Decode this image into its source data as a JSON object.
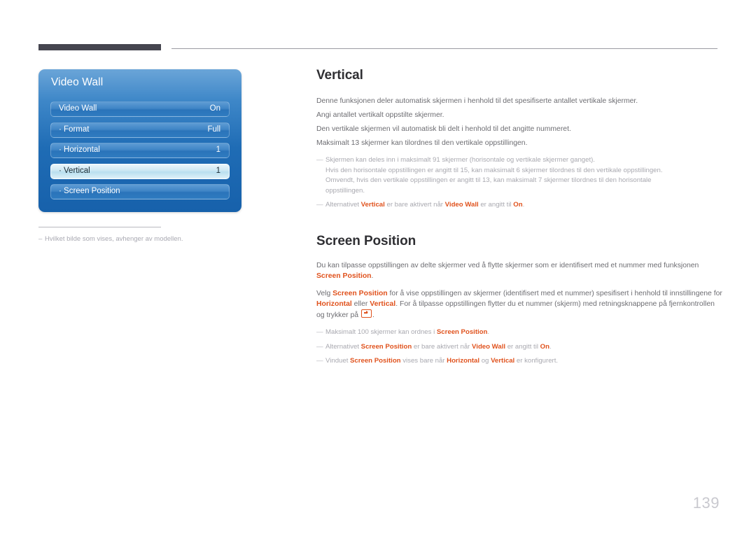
{
  "page": {
    "number": "139"
  },
  "osd": {
    "title": "Video Wall",
    "rows": [
      {
        "label": "Video Wall",
        "value": "On",
        "selected": false
      },
      {
        "label": "· Format",
        "value": "Full",
        "selected": false
      },
      {
        "label": "· Horizontal",
        "value": "1",
        "selected": false
      },
      {
        "label": "· Vertical",
        "value": "1",
        "selected": true
      },
      {
        "label": "· Screen Position",
        "value": "",
        "selected": false
      }
    ]
  },
  "panel_footnote": {
    "dash": "–",
    "text": "Hvilket bilde som vises, avhenger av modellen."
  },
  "vertical_section": {
    "heading": "Vertical",
    "lines": [
      "Denne funksjonen deler automatisk skjermen i henhold til det spesifiserte antallet vertikale skjermer.",
      "Angi antallet vertikalt oppstilte skjermer.",
      "Den vertikale skjermen vil automatisk bli delt i henhold til det angitte nummeret.",
      "Maksimalt 13 skjermer kan tilordnes til den vertikale oppstillingen."
    ],
    "note1": {
      "dash": "—",
      "line1": "Skjermen kan deles inn i maksimalt 91 skjermer (horisontale og vertikale skjermer ganget).",
      "line2": "Hvis den horisontale oppstillingen er angitt til 15, kan maksimalt 6 skjermer tilordnes til den vertikale oppstillingen.",
      "line3": "Omvendt, hvis den vertikale oppstillingen er angitt til 13, kan maksimalt 7 skjermer tilordnes til den horisontale",
      "line4": "oppstillingen."
    },
    "note2": {
      "dash": "—",
      "part1": "Alternativet ",
      "kw1": "Vertical",
      "part2": " er bare aktivert når ",
      "kw2": "Video Wall",
      "part3": " er angitt til ",
      "kw3": "On",
      "part4": "."
    }
  },
  "screen_position_section": {
    "heading": "Screen Position",
    "para1": {
      "line1": "Du kan tilpasse oppstillingen av delte skjermer ved å flytte skjermer som er identifisert med et nummer med funksjonen",
      "kw1": "Screen Position",
      "tail1": "."
    },
    "para2": {
      "a": "Velg ",
      "kw1": "Screen Position",
      "b": " for å vise oppstillingen av skjermer (identifisert med et nummer) spesifisert i henhold til innstillingene for ",
      "kw2": "Horizontal",
      "c": " eller ",
      "kw3": "Vertical",
      "d": ". For å tilpasse oppstillingen flytter du et nummer (skjerm) med retningsknappene på fjernkontrollen",
      "e": "og trykker på ",
      "f": "."
    },
    "notes": [
      {
        "dash": "—",
        "a": "Maksimalt 100 skjermer kan ordnes i ",
        "kw1": "Screen Position",
        "b": "."
      },
      {
        "dash": "—",
        "a": "Alternativet ",
        "kw1": "Screen Position",
        "b": " er bare aktivert når ",
        "kw2": "Video Wall",
        "c": " er angitt til ",
        "kw3": "On",
        "d": "."
      },
      {
        "dash": "—",
        "a": "Vinduet ",
        "kw1": "Screen Position",
        "b": " vises bare når ",
        "kw2": "Horizontal",
        "c": " og ",
        "kw3": "Vertical",
        "d": " er konfigurert."
      }
    ]
  }
}
